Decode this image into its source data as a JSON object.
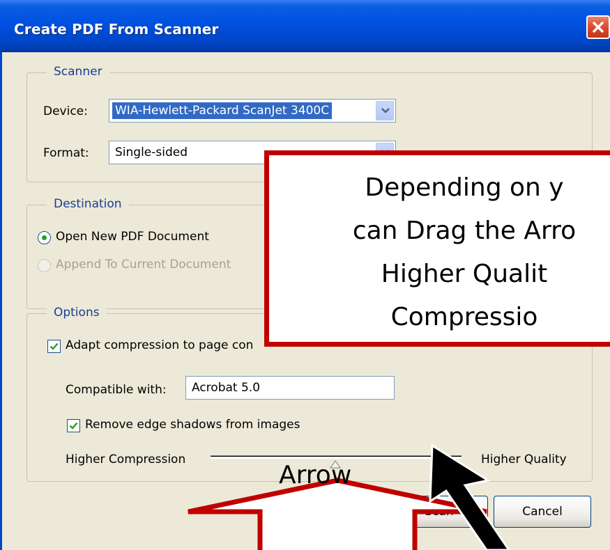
{
  "window": {
    "title": "Create PDF From Scanner",
    "close_icon": "close-icon"
  },
  "scanner": {
    "legend": "Scanner",
    "device_label": "Device:",
    "device_value": "WIA-Hewlett-Packard ScanJet 3400C",
    "format_label": "Format:",
    "format_value": "Single-sided"
  },
  "destination": {
    "legend": "Destination",
    "open_new_label": "Open New PDF Document",
    "open_new_selected": true,
    "append_label": "Append To Current Document",
    "append_enabled": false
  },
  "options": {
    "legend": "Options",
    "adapt_compression_label": "Adapt compression to page con",
    "adapt_compression_checked": true,
    "compatible_label": "Compatible with:",
    "compatible_value": "Acrobat 5.0",
    "remove_shadows_label": "Remove edge shadows from images",
    "remove_shadows_checked": true,
    "slider_left_label": "Higher Compression",
    "slider_right_label": "Higher Quality"
  },
  "buttons": {
    "scan_label": "Scan",
    "cancel_label": "Cancel"
  },
  "callout": {
    "lines": [
      "Depending on y",
      "can Drag the Arro",
      "Higher Qualit",
      "Compressio"
    ],
    "arrow_label": "Arrow"
  },
  "colors": {
    "callout_border": "#c00000",
    "titlebar": "#0052e3",
    "dialog_bg": "#ece9d8",
    "legend_text": "#1c3c8c"
  }
}
